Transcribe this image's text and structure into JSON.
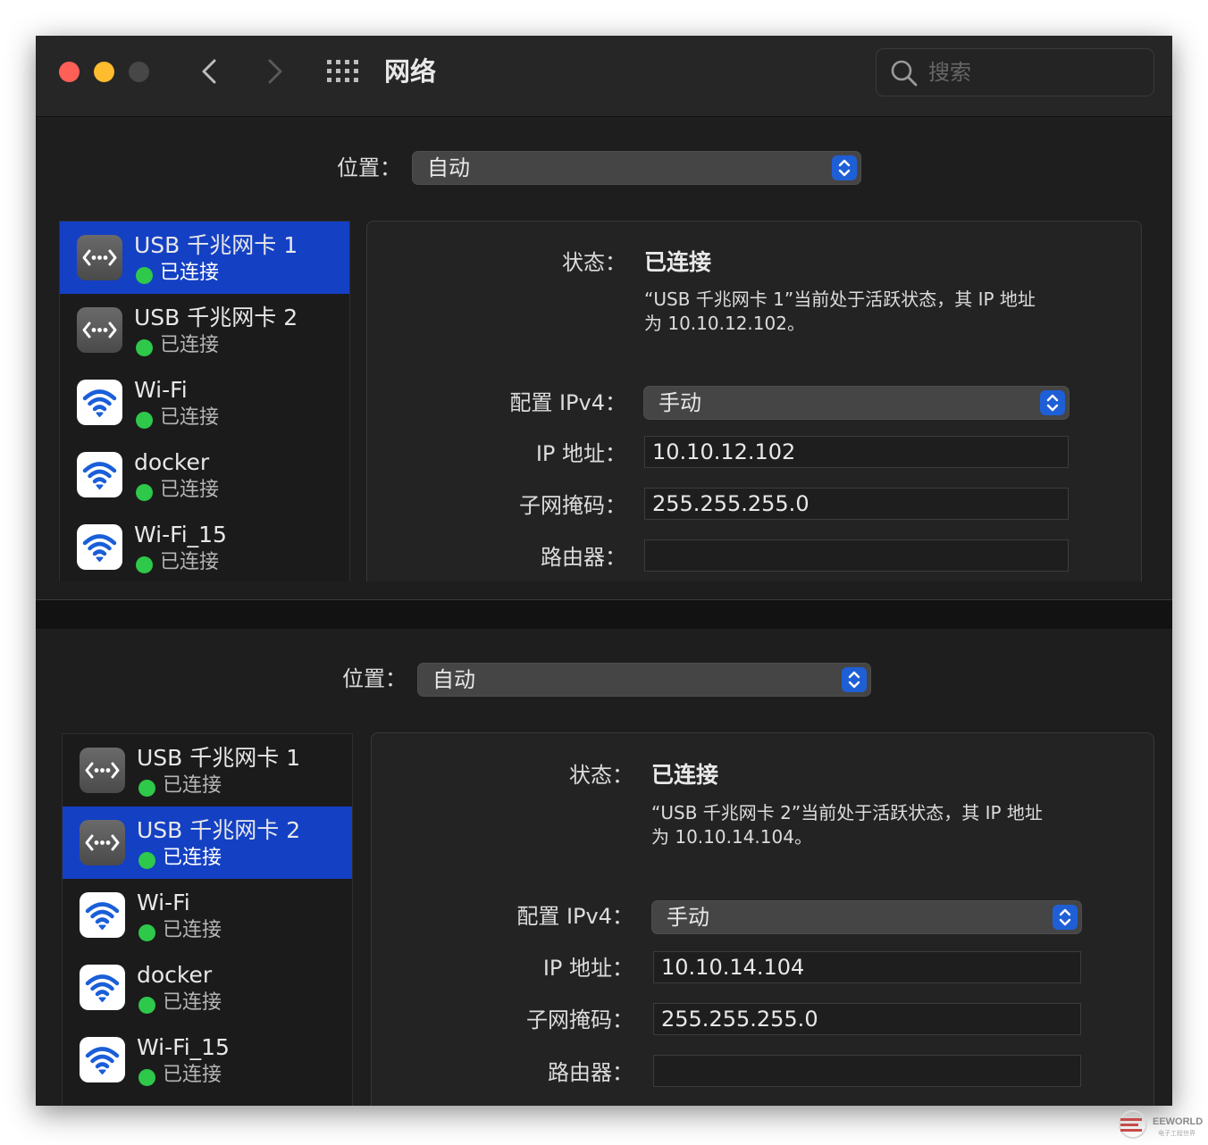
{
  "window": {
    "title": "网络",
    "search_placeholder": "搜索"
  },
  "panes": [
    {
      "location_label": "位置：",
      "location_value": "自动",
      "services": [
        {
          "name": "USB 千兆网卡 1",
          "status": "已连接",
          "icon": "ethernet-icon",
          "selected": true
        },
        {
          "name": "USB 千兆网卡 2",
          "status": "已连接",
          "icon": "ethernet-icon",
          "selected": false
        },
        {
          "name": "Wi-Fi",
          "status": "已连接",
          "icon": "wifi-icon",
          "selected": false
        },
        {
          "name": "docker",
          "status": "已连接",
          "icon": "wifi-icon",
          "selected": false
        },
        {
          "name": "Wi-Fi_15",
          "status": "已连接",
          "icon": "wifi-icon",
          "selected": false
        }
      ],
      "detail": {
        "status_label": "状态：",
        "status_value": "已连接",
        "description_line1": "“USB 千兆网卡 1”当前处于活跃状态，其 IP 地址",
        "description_line2": "为 10.10.12.102。",
        "ipv4_label": "配置 IPv4：",
        "ipv4_value": "手动",
        "ip_label": "IP 地址：",
        "ip_value": "10.10.12.102",
        "mask_label": "子网掩码：",
        "mask_value": "255.255.255.0",
        "router_label": "路由器：",
        "router_value": ""
      }
    },
    {
      "location_label": "位置：",
      "location_value": "自动",
      "services": [
        {
          "name": "USB 千兆网卡 1",
          "status": "已连接",
          "icon": "ethernet-icon",
          "selected": false
        },
        {
          "name": "USB 千兆网卡 2",
          "status": "已连接",
          "icon": "ethernet-icon",
          "selected": true
        },
        {
          "name": "Wi-Fi",
          "status": "已连接",
          "icon": "wifi-icon",
          "selected": false
        },
        {
          "name": "docker",
          "status": "已连接",
          "icon": "wifi-icon",
          "selected": false
        },
        {
          "name": "Wi-Fi_15",
          "status": "已连接",
          "icon": "wifi-icon",
          "selected": false
        }
      ],
      "detail": {
        "status_label": "状态：",
        "status_value": "已连接",
        "description_line1": "“USB 千兆网卡 2”当前处于活跃状态，其 IP 地址",
        "description_line2": "为 10.10.14.104。",
        "ipv4_label": "配置 IPv4：",
        "ipv4_value": "手动",
        "ip_label": "IP 地址：",
        "ip_value": "10.10.14.104",
        "mask_label": "子网掩码：",
        "mask_value": "255.255.255.0",
        "router_label": "路由器：",
        "router_value": ""
      }
    }
  ],
  "watermark": {
    "text": "EEWORLD",
    "sub": "电子工程世界"
  },
  "colors": {
    "selection": "#1440c4",
    "accent": "#1f5fd6",
    "status_green": "#2ec84a",
    "wifi_blue": "#1a5fd8"
  }
}
